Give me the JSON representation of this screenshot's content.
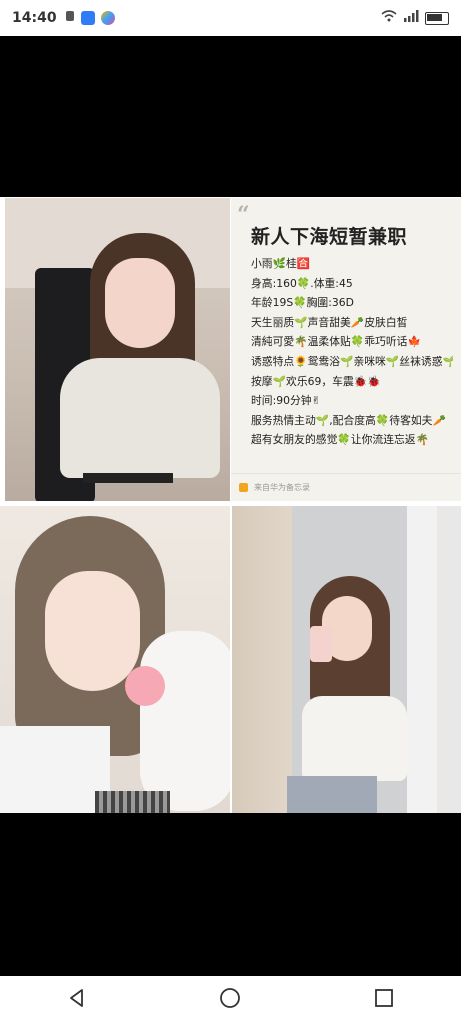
{
  "status_bar": {
    "time": "14:40",
    "icons": [
      "notification-icon",
      "app-badge-icon",
      "app-badge-icon",
      "wifi-icon",
      "signal-icon",
      "battery-icon"
    ]
  },
  "card": {
    "quote_mark": "“",
    "title": "新人下海短暂兼职",
    "lines": [
      "小雨🌿桂🈴",
      "身高:160🍀.体重:45",
      "年龄19S🍀胸圍:36D",
      "天生丽质🌱声音甜美🥕皮肤白皙",
      "清純可愛🌴温柔体贴🍀乖巧听话🍁",
      "诱惑特点🌻鸳鸯浴🌱亲咪咪🌱丝袜诱惑🌱",
      "按摩🌱欢乐69，车震🐞🐞",
      "时间:90分钟✌",
      "服务热情主动🌱,配合度高🍀待客如夫🥕",
      "超有女朋友的感觉🍀让你流连忘返🌴"
    ],
    "source": "来自华为备忘录"
  },
  "colors": {
    "card_bg": "#f4f2ec",
    "nav_bg": "#ffffff",
    "letterbox": "#000000"
  },
  "nav": {
    "back": "back-icon",
    "home": "home-icon",
    "recents": "recents-icon"
  }
}
